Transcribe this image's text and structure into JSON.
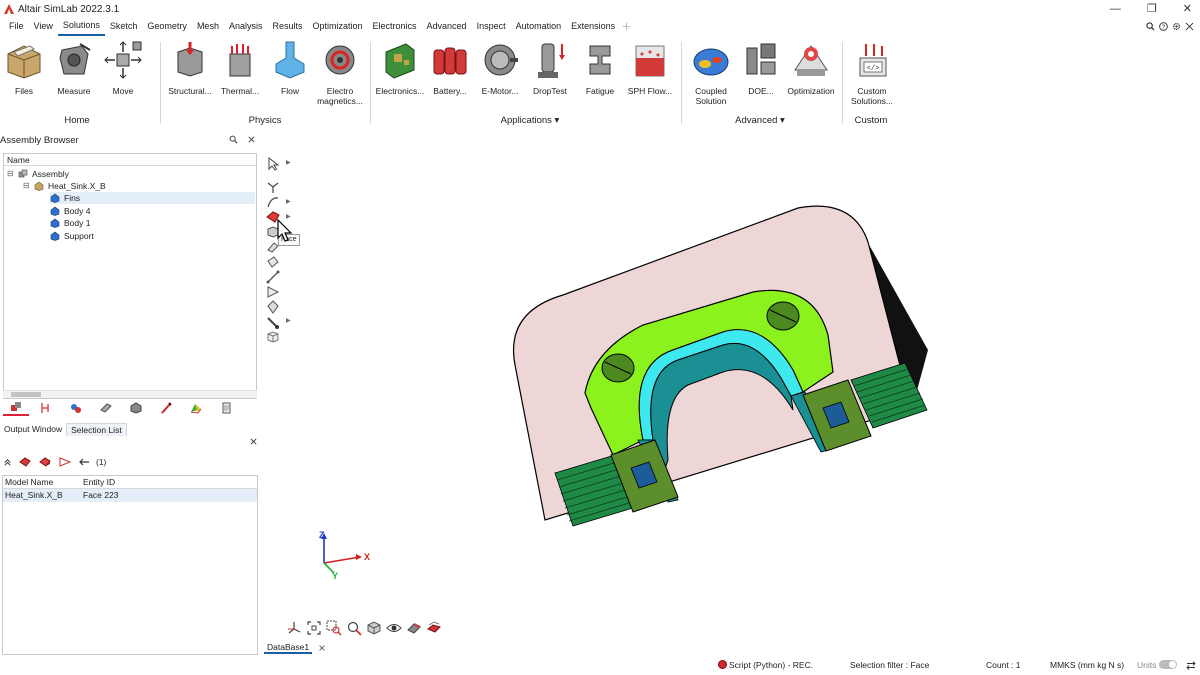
{
  "app": {
    "title": "Altair SimLab 2022.3.1",
    "window_controls": [
      "—",
      "❐",
      "✕"
    ]
  },
  "menubar": {
    "items": [
      "File",
      "View",
      "Solutions",
      "Sketch",
      "Geometry",
      "Mesh",
      "Analysis",
      "Results",
      "Optimization",
      "Electronics",
      "Advanced",
      "Inspect",
      "Automation",
      "Extensions"
    ],
    "active": "Solutions"
  },
  "ribbon": {
    "buttons": [
      {
        "label": "Files",
        "icon": "files-icon"
      },
      {
        "label": "Measure",
        "icon": "measure-icon"
      },
      {
        "label": "Move",
        "icon": "move-icon"
      },
      {
        "label": "Structural...",
        "icon": "structural-icon"
      },
      {
        "label": "Thermal...",
        "icon": "thermal-icon"
      },
      {
        "label": "Flow",
        "icon": "flow-icon"
      },
      {
        "label": "Electro\nmagnetics...",
        "icon": "electromagnetics-icon"
      },
      {
        "label": "Electronics...",
        "icon": "electronics-icon"
      },
      {
        "label": "Battery...",
        "icon": "battery-icon"
      },
      {
        "label": "E-Motor...",
        "icon": "e-motor-icon"
      },
      {
        "label": "DropTest",
        "icon": "droptest-icon"
      },
      {
        "label": "Fatigue",
        "icon": "fatigue-icon"
      },
      {
        "label": "SPH Flow...",
        "icon": "sph-flow-icon"
      },
      {
        "label": "Coupled\nSolution",
        "icon": "coupled-solution-icon"
      },
      {
        "label": "DOE...",
        "icon": "doe-icon"
      },
      {
        "label": "Optimization",
        "icon": "optimization-icon"
      },
      {
        "label": "Custom\nSolutions...",
        "icon": "custom-solutions-icon"
      }
    ],
    "groups": [
      {
        "label": "Home"
      },
      {
        "label": "Physics"
      },
      {
        "label": "Applications ▾"
      },
      {
        "label": "Advanced ▾"
      },
      {
        "label": "Custom"
      }
    ]
  },
  "assembly_browser": {
    "title": "Assembly Browser",
    "column": "Name",
    "items": [
      {
        "label": "Assembly",
        "icon": "assembly-icon",
        "expander": "⊟"
      },
      {
        "label": "Heat_Sink.X_B",
        "icon": "part-icon",
        "expander": "⊟"
      },
      {
        "label": "Fins",
        "icon": "body-icon",
        "expander": ""
      },
      {
        "label": "Body 4",
        "icon": "body-icon",
        "expander": ""
      },
      {
        "label": "Body 1",
        "icon": "body-icon",
        "expander": ""
      },
      {
        "label": "Support",
        "icon": "body-icon",
        "expander": ""
      }
    ],
    "selected": "Fins"
  },
  "output": {
    "tabs": [
      "Output Window",
      "Selection List"
    ],
    "active": "Selection List",
    "count_label": "(1)",
    "columns": [
      "Model Name",
      "Entity ID"
    ],
    "rows": [
      [
        "Heat_Sink.X_B",
        "Face 223"
      ]
    ]
  },
  "viewport": {
    "tooltip": "Face",
    "database_tab": "DataBase1",
    "axes": {
      "x": "X",
      "y": "Y",
      "z": "Z"
    },
    "colors": {
      "background": "#ffffff",
      "base_plate": "#efd6d6",
      "support": "#8cf21e",
      "inner_ring": "#3de8ee",
      "inner_surface": "#1a8f94",
      "fins": "#1f8a45",
      "edges": "#000000"
    }
  },
  "statusbar": {
    "script": "Script (Python) - REC.",
    "selection_filter": "Selection filter : Face",
    "count": "Count : 1",
    "units_system": "MMKS (mm kg N s)",
    "units_label": "Units"
  }
}
